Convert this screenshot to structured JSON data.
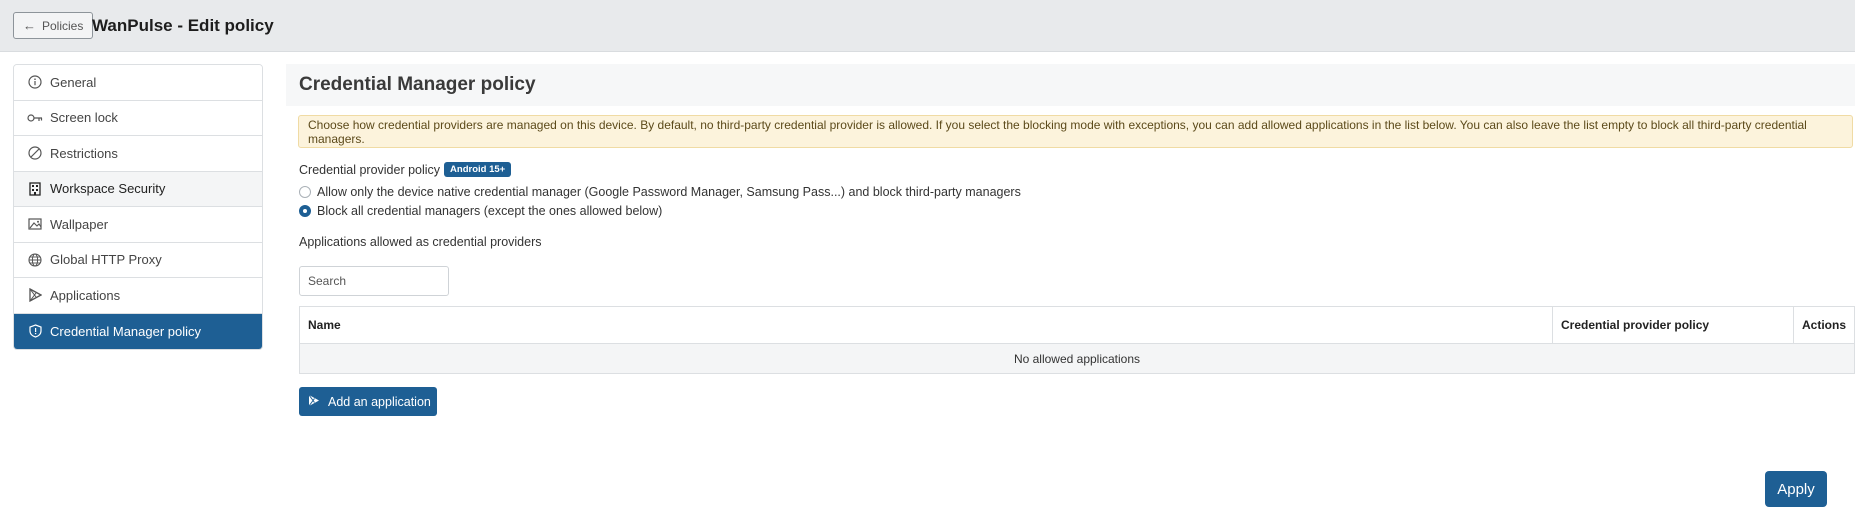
{
  "header": {
    "back_label": "Policies",
    "title": "WanPulse - Edit policy"
  },
  "sidebar": {
    "items": [
      {
        "label": "General",
        "icon": "info-circle-icon"
      },
      {
        "label": "Screen lock",
        "icon": "key-icon"
      },
      {
        "label": "Restrictions",
        "icon": "no-entry-icon"
      },
      {
        "label": "Workspace Security",
        "icon": "building-icon"
      },
      {
        "label": "Wallpaper",
        "icon": "image-icon"
      },
      {
        "label": "Global HTTP Proxy",
        "icon": "globe-icon"
      },
      {
        "label": "Applications",
        "icon": "play-store-icon"
      },
      {
        "label": "Credential Manager policy",
        "icon": "shield-icon"
      }
    ],
    "active_index": 7
  },
  "main": {
    "title": "Credential Manager policy",
    "alert": "Choose how credential providers are managed on this device. By default, no third-party credential provider is allowed. If you select the blocking mode with exceptions, you can add allowed applications in the list below. You can also leave the list empty to block all third-party credential managers.",
    "policy_label": "Credential provider policy",
    "policy_badge": "Android 15+",
    "options": [
      {
        "label": "Allow only the device native credential manager (Google Password Manager, Samsung Pass...) and block third-party managers",
        "checked": false
      },
      {
        "label": "Block all credential managers (except the ones allowed below)",
        "checked": true
      }
    ],
    "apps_label": "Applications allowed as credential providers",
    "search_placeholder": "Search",
    "table": {
      "columns": [
        "Name",
        "Credential provider policy",
        "Actions"
      ],
      "empty_text": "No allowed applications"
    },
    "add_label": "Add an application",
    "apply_label": "Apply"
  },
  "colors": {
    "accent": "#1e5f94",
    "alert_bg": "#fcf3dc"
  }
}
